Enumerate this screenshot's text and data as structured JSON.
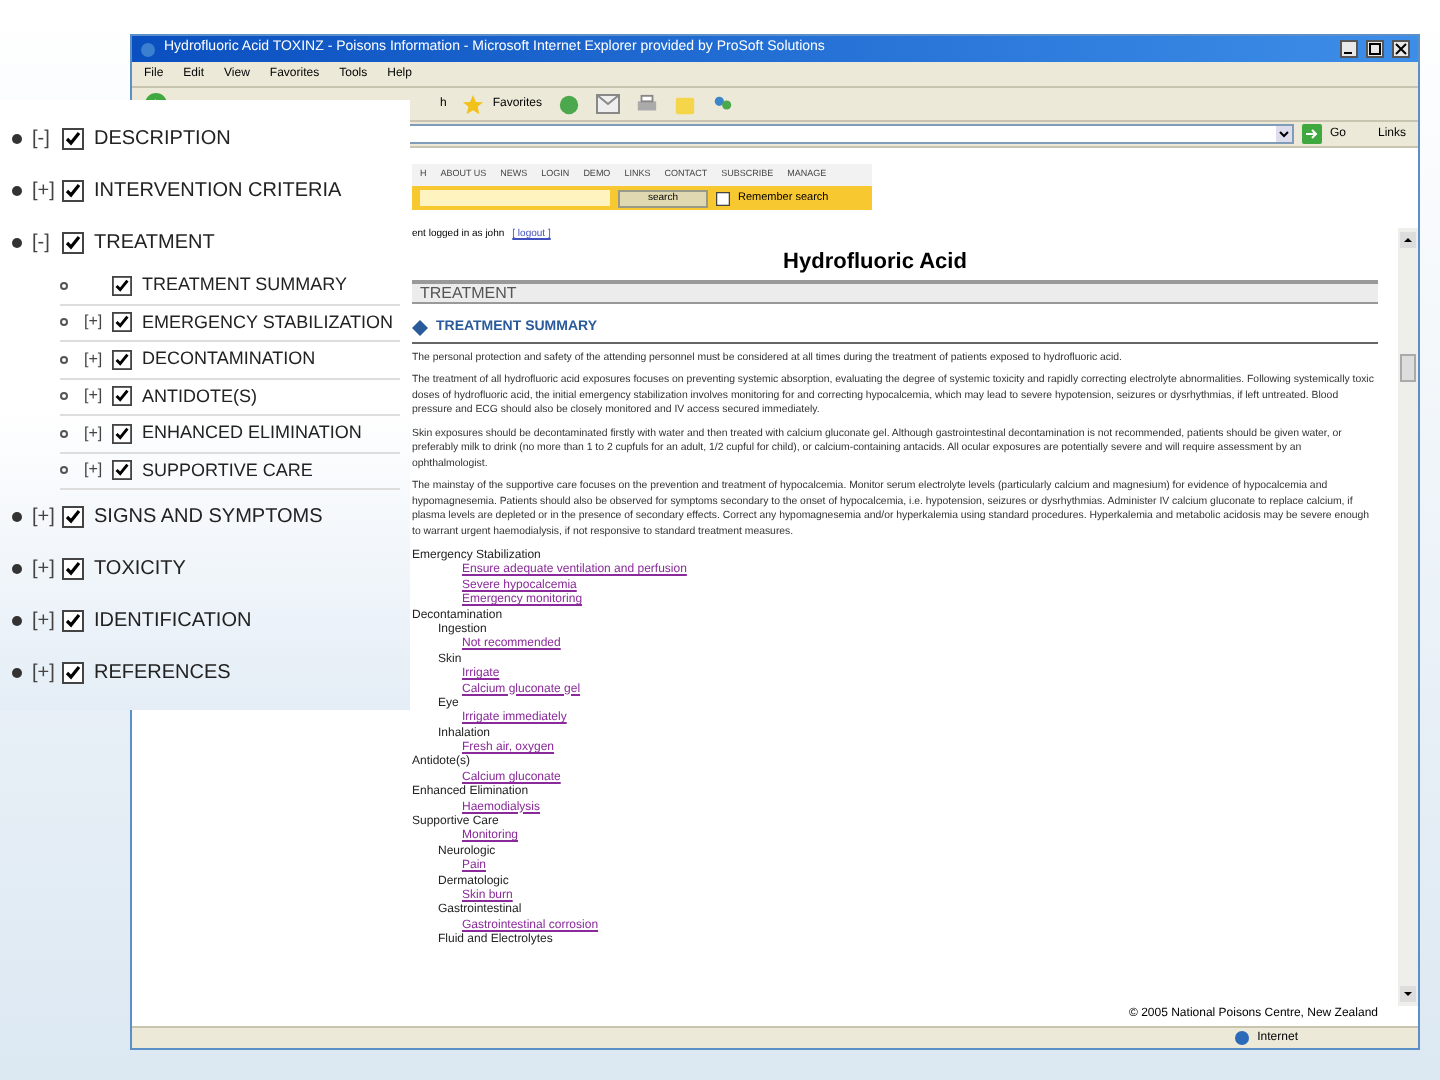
{
  "browser": {
    "title": "Hydrofluoric Acid TOXINZ - Poisons Information - Microsoft Internet Explorer provided by ProSoft Solutions",
    "menu": [
      "File",
      "Edit",
      "View",
      "Favorites",
      "Tools",
      "Help"
    ],
    "toolbar": {
      "search_label": "h",
      "favorites_label": "Favorites"
    },
    "address_bar": {
      "go": "Go",
      "links": "Links"
    },
    "status_bar": {
      "zone": "Internet"
    }
  },
  "page": {
    "nav": [
      "H",
      "ABOUT US",
      "NEWS",
      "LOGIN",
      "DEMO",
      "LINKS",
      "CONTACT",
      "SUBSCRIBE",
      "MANAGE"
    ],
    "search_button": "search",
    "remember_search": {
      "label": "Remember search",
      "checked": false
    },
    "login": {
      "text": "ent logged in as john",
      "link": "[ logout ]"
    },
    "title": "Hydrofluoric Acid",
    "section_bar": "TREATMENT",
    "subsection": "TREATMENT SUMMARY",
    "paragraphs": [
      "The personal protection and safety of the attending personnel must be considered at all times during the treatment of patients exposed to hydrofluoric acid.",
      "The treatment of all hydrofluoric acid exposures focuses on preventing systemic absorption, evaluating the degree of systemic toxicity and rapidly correcting electrolyte abnormalities. Following systemically toxic doses of hydrofluoric acid, the initial emergency stabilization involves monitoring for and correcting hypocalcemia, which may lead to severe hypotension, seizures or dysrhythmias, if left untreated. Blood pressure and ECG should also be closely monitored and IV access secured immediately.",
      "Skin exposures should be decontaminated firstly with water and then treated with calcium gluconate gel. Although gastrointestinal decontamination is not recommended, patients should be given water, or preferably milk to drink (no more than 1 to 2 cupfuls for an adult, 1/2 cupful for child), or calcium-containing antacids. All ocular exposures are potentially severe and will require assessment by an ophthalmologist.",
      "The mainstay of the supportive care focuses on the prevention and treatment of hypocalcemia. Monitor serum electrolyte levels (particularly calcium and magnesium) for evidence of hypocalcemia and hypomagnesemia. Patients should also be observed for symptoms secondary to the onset of hypocalcemia, i.e. hypotension, seizures or dysrhythmias. Administer IV calcium gluconate to replace calcium, if plasma levels are depleted or in the presence of secondary effects. Correct any hypomagnesemia and/or hyperkalemia using standard procedures. Hyperkalemia and metabolic acidosis may be severe enough to warrant urgent haemodialysis, if not responsive to standard treatment measures."
    ],
    "outline": [
      {
        "kind": "heading",
        "text": "Emergency Stabilization",
        "children": [
          {
            "kind": "link",
            "text": "Ensure adequate ventilation and perfusion"
          },
          {
            "kind": "link",
            "text": "Severe hypocalcemia"
          },
          {
            "kind": "link",
            "text": "Emergency monitoring"
          }
        ]
      },
      {
        "kind": "heading",
        "text": "Decontamination",
        "children": [
          {
            "kind": "heading",
            "text": "Ingestion",
            "children": [
              {
                "kind": "link",
                "text": "Not recommended"
              }
            ]
          },
          {
            "kind": "heading",
            "text": "Skin",
            "children": [
              {
                "kind": "link",
                "text": "Irrigate"
              },
              {
                "kind": "link",
                "text": "Calcium gluconate gel"
              }
            ]
          },
          {
            "kind": "heading",
            "text": "Eye",
            "children": [
              {
                "kind": "link",
                "text": "Irrigate immediately"
              }
            ]
          },
          {
            "kind": "heading",
            "text": "Inhalation",
            "children": [
              {
                "kind": "link",
                "text": "Fresh air, oxygen"
              }
            ]
          }
        ]
      },
      {
        "kind": "heading",
        "text": "Antidote(s)",
        "children": [
          {
            "kind": "link",
            "text": "Calcium gluconate"
          }
        ]
      },
      {
        "kind": "heading",
        "text": "Enhanced Elimination",
        "children": [
          {
            "kind": "link",
            "text": "Haemodialysis"
          }
        ]
      },
      {
        "kind": "heading",
        "text": "Supportive Care",
        "children": [
          {
            "kind": "link",
            "text": "Monitoring"
          },
          {
            "kind": "heading",
            "text": "Neurologic",
            "children": [
              {
                "kind": "link",
                "text": "Pain"
              }
            ]
          },
          {
            "kind": "heading",
            "text": "Dermatologic",
            "children": [
              {
                "kind": "link",
                "text": "Skin burn"
              }
            ]
          },
          {
            "kind": "heading",
            "text": "Gastrointestinal",
            "children": [
              {
                "kind": "link",
                "text": "Gastrointestinal corrosion"
              }
            ]
          },
          {
            "kind": "heading",
            "text": "Fluid and Electrolytes"
          }
        ]
      }
    ],
    "footer": "© 2005 National Poisons Centre, New Zealand"
  },
  "overlay_tree": [
    {
      "toggle": "[-]",
      "label": "DESCRIPTION",
      "checked": true
    },
    {
      "toggle": "[+]",
      "label": "INTERVENTION CRITERIA",
      "checked": true
    },
    {
      "toggle": "[-]",
      "label": "TREATMENT",
      "checked": true,
      "children": [
        {
          "label": "TREATMENT SUMMARY",
          "checked": true
        },
        {
          "toggle": "[+]",
          "label": "EMERGENCY STABILIZATION",
          "checked": true
        },
        {
          "toggle": "[+]",
          "label": "DECONTAMINATION",
          "checked": true
        },
        {
          "toggle": "[+]",
          "label": "ANTIDOTE(S)",
          "checked": true
        },
        {
          "toggle": "[+]",
          "label": "ENHANCED ELIMINATION",
          "checked": true
        },
        {
          "toggle": "[+]",
          "label": "SUPPORTIVE CARE",
          "checked": true
        }
      ]
    },
    {
      "toggle": "[+]",
      "label": "SIGNS AND SYMPTOMS",
      "checked": true
    },
    {
      "toggle": "[+]",
      "label": "TOXICITY",
      "checked": true
    },
    {
      "toggle": "[+]",
      "label": "IDENTIFICATION",
      "checked": true
    },
    {
      "toggle": "[+]",
      "label": "REFERENCES",
      "checked": true
    }
  ]
}
